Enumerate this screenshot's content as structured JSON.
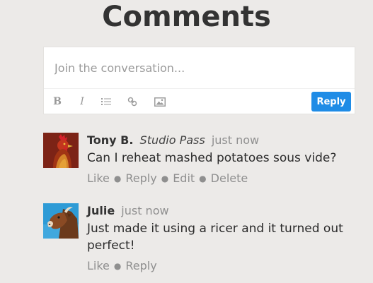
{
  "page": {
    "title": "Comments"
  },
  "composer": {
    "placeholder": "Join the conversation...",
    "toolbar": {
      "bold_label": "B",
      "italic_label": "I",
      "icons": [
        "bold-icon",
        "italic-icon",
        "list-icon",
        "link-icon",
        "image-icon"
      ]
    },
    "reply_label": "Reply",
    "reply_color": "#1f8ce6"
  },
  "comments": [
    {
      "author": "Tony B.",
      "badge": "Studio Pass",
      "time": "just now",
      "text": "Can I reheat mashed potatoes sous vide?",
      "avatar_icon": "rooster-avatar",
      "actions": [
        "Like",
        "Reply",
        "Edit",
        "Delete"
      ]
    },
    {
      "author": "Julie",
      "time": "just now",
      "text": "Just made it using a ricer and it turned out perfect!",
      "avatar_icon": "cow-avatar",
      "actions": [
        "Like",
        "Reply"
      ]
    }
  ]
}
